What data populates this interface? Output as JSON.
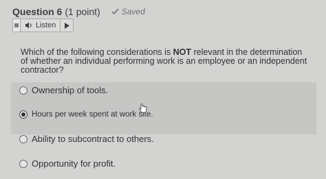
{
  "header": {
    "question_label": "Question 6",
    "points": "(1 point)",
    "saved": "Saved"
  },
  "listen": {
    "label": "Listen"
  },
  "question": {
    "text_before": "Which of the following considerations is ",
    "text_bold": "NOT",
    "text_after": " relevant in the determination of whether an individual performing work is an employee or an independent contractor?"
  },
  "options": [
    {
      "label": "Ownership of tools.",
      "selected": false
    },
    {
      "label": "Hours per week spent at work site.",
      "selected": true
    },
    {
      "label": "Ability to subcontract to others.",
      "selected": false
    },
    {
      "label": "Opportunity for profit.",
      "selected": false
    }
  ]
}
